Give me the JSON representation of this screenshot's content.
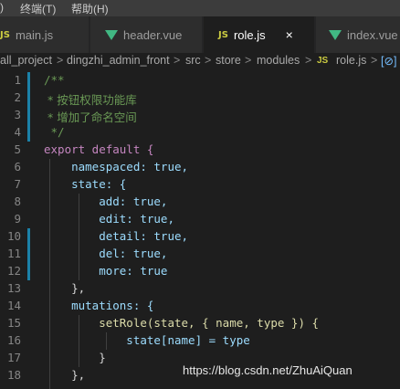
{
  "menu": {
    "items": [
      ")",
      "终端(T)",
      "帮助(H)"
    ]
  },
  "tabs": [
    {
      "label": "main.js",
      "icon": "js-file-icon",
      "active": false
    },
    {
      "label": "header.vue",
      "icon": "vue-file-icon",
      "active": false
    },
    {
      "label": "role.js",
      "icon": "js-file-icon",
      "active": true,
      "close": "×"
    },
    {
      "label": "index.vue",
      "icon": "vue-file-icon",
      "active": false
    }
  ],
  "breadcrumb": {
    "parts": [
      "all_project",
      "dingzhi_admin_front",
      "src",
      "store",
      "modules",
      "role.js",
      "[⊘]"
    ],
    "separator": ">"
  },
  "editor": {
    "line_numbers": [
      "1",
      "2",
      "3",
      "4",
      "5",
      "6",
      "7",
      "8",
      "9",
      "10",
      "11",
      "12",
      "13",
      "14",
      "15",
      "16",
      "17",
      "18"
    ],
    "lines": [
      "/**",
      " * 按钮权限功能库",
      " * 增加了命名空间",
      " */",
      "export default {",
      "    namespaced: true,",
      "    state: {",
      "        add: true,",
      "        edit: true,",
      "        detail: true,",
      "        del: true,",
      "        more: true",
      "    },",
      "    mutations: {",
      "        setRole(state, { name, type }) {",
      "            state[name] = type",
      "        }",
      "    },"
    ]
  },
  "watermark": "https://blog.csdn.net/ZhuAiQuan",
  "colors": {
    "comment": "#6a9955",
    "keyword": "#c586c0",
    "property": "#9cdcfe",
    "boolean": "#569cd6",
    "function": "#dcdcaa",
    "modified_gutter": "#1b81a8"
  }
}
